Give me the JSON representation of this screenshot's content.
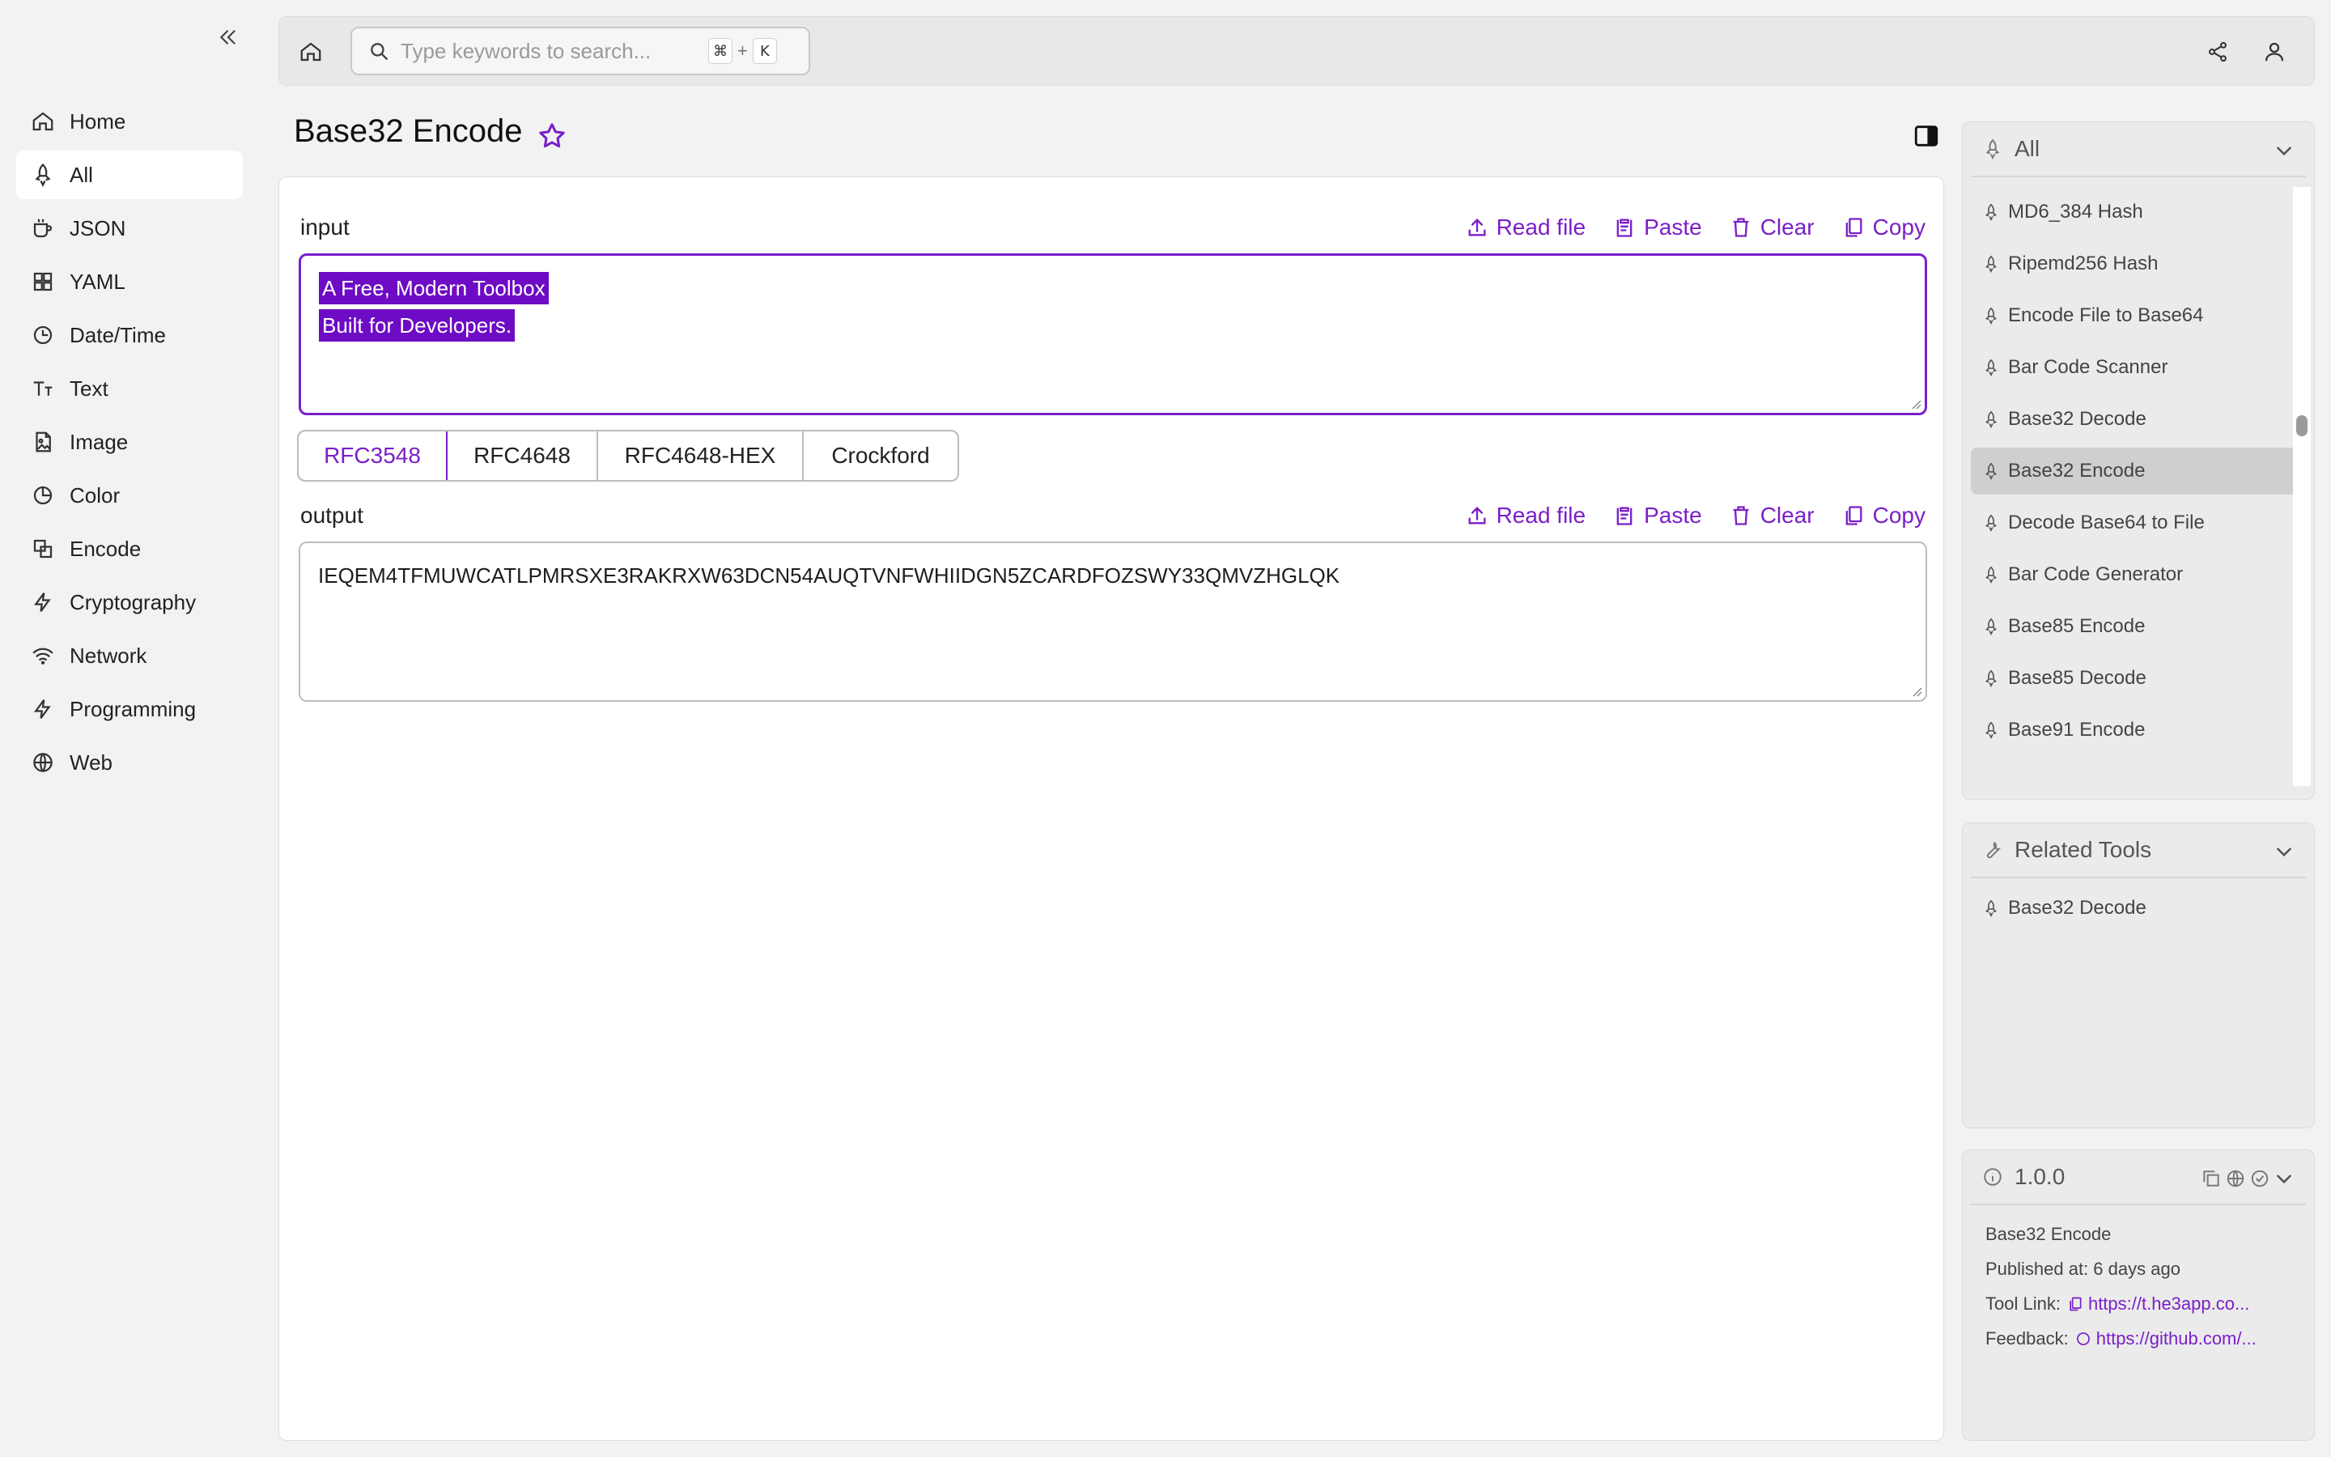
{
  "sidebar": {
    "items": [
      {
        "label": "Home",
        "icon": "home-icon"
      },
      {
        "label": "All",
        "icon": "rocket-icon",
        "active": true
      },
      {
        "label": "JSON",
        "icon": "mug-icon"
      },
      {
        "label": "YAML",
        "icon": "grid-icon"
      },
      {
        "label": "Date/Time",
        "icon": "clock-icon"
      },
      {
        "label": "Text",
        "icon": "text-icon"
      },
      {
        "label": "Image",
        "icon": "image-icon"
      },
      {
        "label": "Color",
        "icon": "palette-icon"
      },
      {
        "label": "Encode",
        "icon": "encode-icon"
      },
      {
        "label": "Cryptography",
        "icon": "bolt-icon"
      },
      {
        "label": "Network",
        "icon": "wifi-icon"
      },
      {
        "label": "Programming",
        "icon": "bolt-icon"
      },
      {
        "label": "Web",
        "icon": "globe-icon"
      }
    ]
  },
  "search": {
    "placeholder": "Type keywords to search...",
    "shortcut_mod": "⌘",
    "shortcut_plus": "+",
    "shortcut_key": "K"
  },
  "page": {
    "title": "Base32 Encode"
  },
  "input": {
    "label": "input",
    "lines": [
      "A Free, Modern Toolbox",
      "Built for Developers."
    ]
  },
  "actions": {
    "read_file": "Read file",
    "paste": "Paste",
    "clear": "Clear",
    "copy": "Copy"
  },
  "variants": [
    "RFC3548",
    "RFC4648",
    "RFC4648-HEX",
    "Crockford"
  ],
  "output": {
    "label": "output",
    "value": "IEQEM4TFMUWCATLPMRSXE3RAKRXW63DCN54AUQTVNFWHIIDGN5ZCARDFOZSWY33QMVZHGLQK"
  },
  "all_panel": {
    "title": "All",
    "items": [
      "MD6_384 Hash",
      "Ripemd256 Hash",
      "Encode File to Base64",
      "Bar Code Scanner",
      "Base32 Decode",
      "Base32 Encode",
      "Decode Base64 to File",
      "Bar Code Generator",
      "Base85 Encode",
      "Base85 Decode",
      "Base91 Encode"
    ],
    "active_index": 5
  },
  "related_panel": {
    "title": "Related Tools",
    "items": [
      "Base32 Decode"
    ]
  },
  "version_panel": {
    "version": "1.0.0",
    "tool_name": "Base32 Encode",
    "published": "Published at: 6 days ago",
    "tool_link_label": "Tool Link:",
    "tool_link": "https://t.he3app.co...",
    "feedback_label": "Feedback:",
    "feedback_link": "https://github.com/..."
  },
  "colors": {
    "accent": "#7a1fc8",
    "selection": "#6e0bc4"
  }
}
